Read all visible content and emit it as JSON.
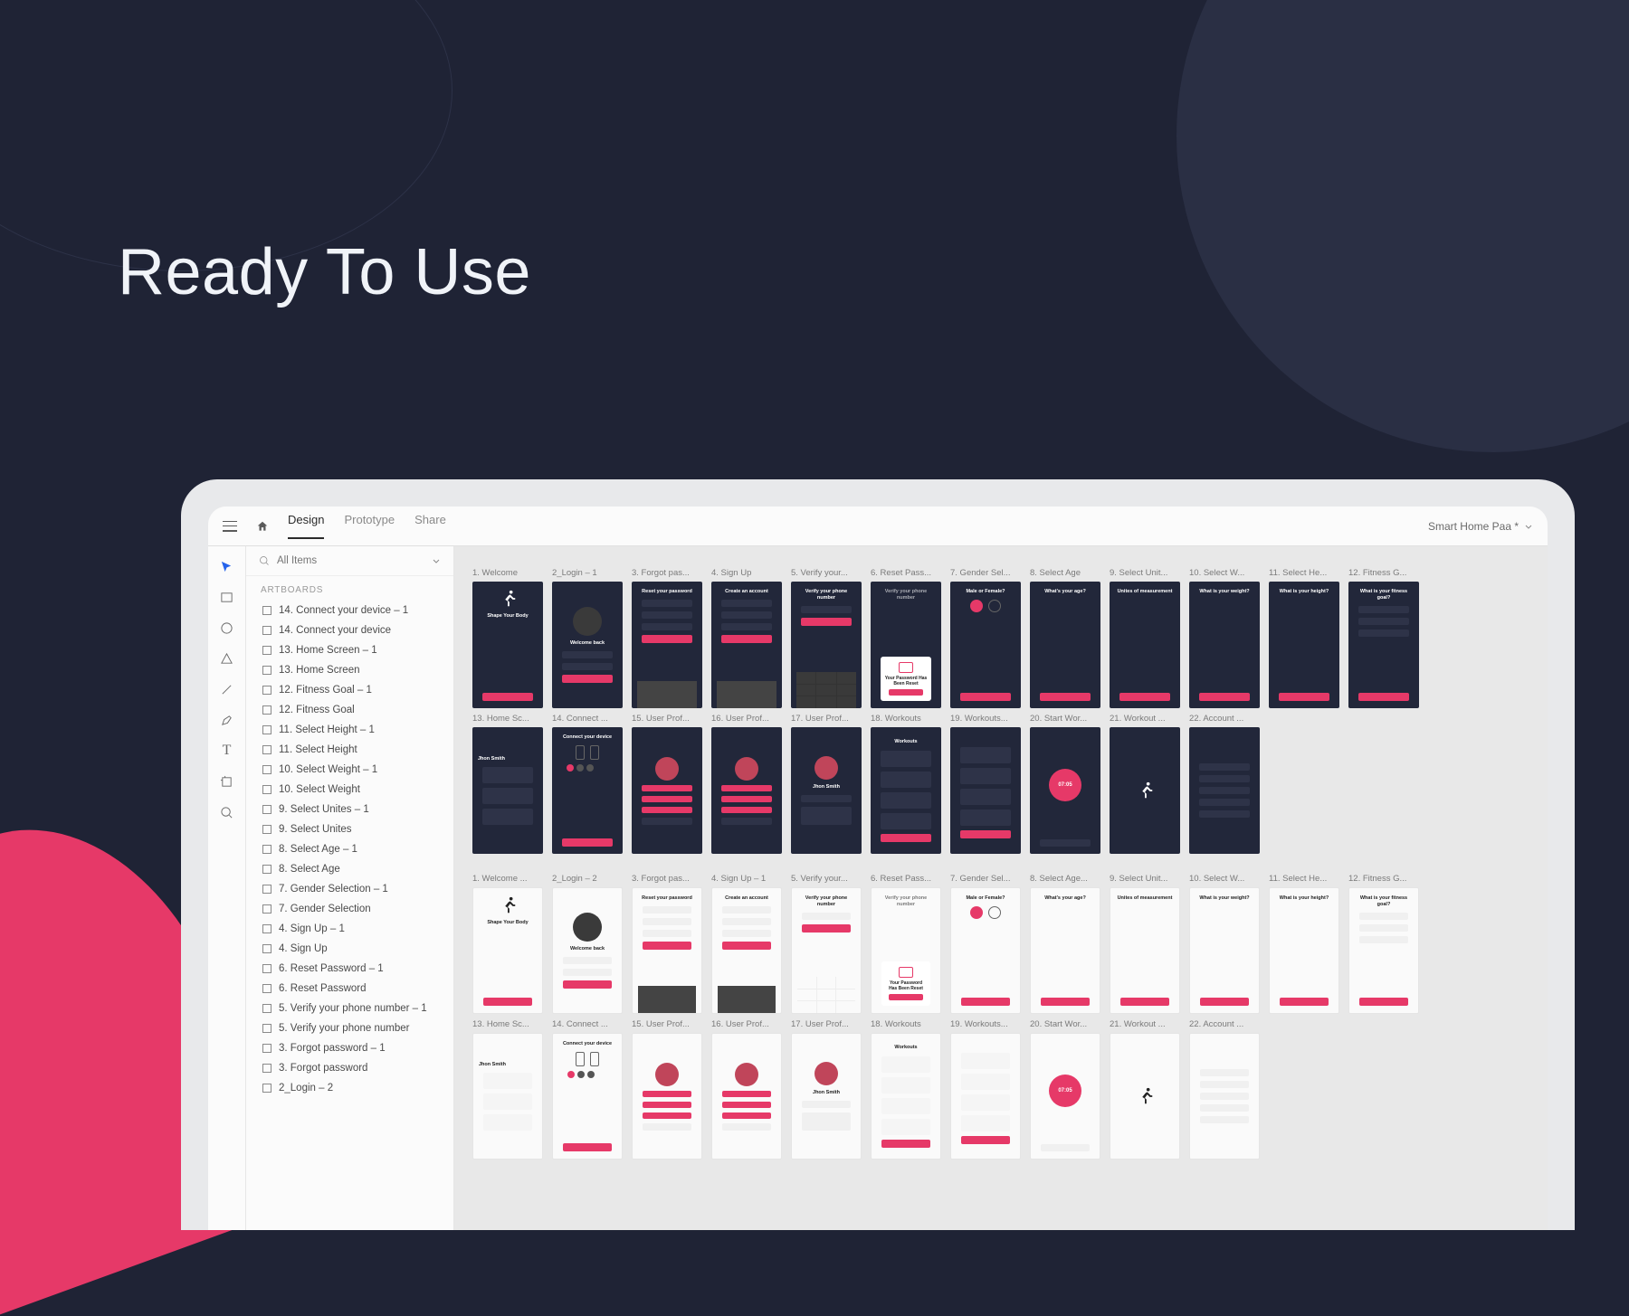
{
  "hero": "Ready To Use",
  "topbar": {
    "tabs": [
      "Design",
      "Prototype",
      "Share"
    ],
    "activeTab": 0,
    "docTitle": "Smart Home Paa *"
  },
  "layers": {
    "searchPlaceholder": "All Items",
    "sectionHeader": "ARTBOARDS",
    "items": [
      "14. Connect your device – 1",
      "14. Connect your device",
      "13. Home Screen – 1",
      "13. Home Screen",
      "12. Fitness Goal – 1",
      "12. Fitness Goal",
      "11. Select Height – 1",
      "11. Select Height",
      "10. Select Weight – 1",
      "10. Select Weight",
      "9. Select Unites – 1",
      "9. Select Unites",
      "8. Select Age – 1",
      "8. Select Age",
      "7. Gender Selection – 1",
      "7. Gender Selection",
      "4. Sign Up – 1",
      "4. Sign Up",
      "6. Reset Password – 1",
      "6. Reset Password",
      "5. Verify your phone number – 1",
      "5. Verify your phone number",
      "3. Forgot password – 1",
      "3. Forgot password",
      "2_Login – 2"
    ]
  },
  "artboardRows": [
    [
      {
        "label": "1. Welcome",
        "theme": "dark",
        "title": "Shape Your Body",
        "kind": "welcome"
      },
      {
        "label": "2_Login – 1",
        "theme": "dark",
        "title": "Welcome back",
        "kind": "login"
      },
      {
        "label": "3. Forgot pas...",
        "theme": "dark",
        "title": "Reset your password",
        "kind": "form"
      },
      {
        "label": "4. Sign Up",
        "theme": "dark",
        "title": "Create an account",
        "kind": "form"
      },
      {
        "label": "5. Verify your...",
        "theme": "dark",
        "title": "Verify your phone number",
        "kind": "verify"
      },
      {
        "label": "6. Reset Pass...",
        "theme": "dark",
        "title": "Your Password Has Been Reset",
        "kind": "modal"
      },
      {
        "label": "7. Gender Sel...",
        "theme": "dark",
        "title": "Male or Female?",
        "kind": "gender"
      },
      {
        "label": "8. Select Age",
        "theme": "dark",
        "title": "What's your age?",
        "kind": "picker"
      },
      {
        "label": "9. Select Unit...",
        "theme": "dark",
        "title": "Unites of measurement",
        "kind": "picker"
      },
      {
        "label": "10. Select W...",
        "theme": "dark",
        "title": "What is your weight?",
        "kind": "picker"
      },
      {
        "label": "11. Select He...",
        "theme": "dark",
        "title": "What is your height?",
        "kind": "picker"
      },
      {
        "label": "12. Fitness G...",
        "theme": "dark",
        "title": "What is your fitness goal?",
        "kind": "list"
      }
    ],
    [
      {
        "label": "13. Home Sc...",
        "theme": "dark",
        "title": "Jhon Smith",
        "kind": "home"
      },
      {
        "label": "14. Connect ...",
        "theme": "dark",
        "title": "Connect your device",
        "kind": "connect"
      },
      {
        "label": "15. User Prof...",
        "theme": "dark",
        "title": "",
        "kind": "profile"
      },
      {
        "label": "16. User Prof...",
        "theme": "dark",
        "title": "",
        "kind": "profile"
      },
      {
        "label": "17. User Prof...",
        "theme": "dark",
        "title": "Jhon Smith",
        "kind": "profile2"
      },
      {
        "label": "18. Workouts",
        "theme": "dark",
        "title": "Workouts",
        "kind": "workouts"
      },
      {
        "label": "19. Workouts...",
        "theme": "dark",
        "title": "",
        "kind": "workouts"
      },
      {
        "label": "20. Start Wor...",
        "theme": "dark",
        "title": "07:05",
        "kind": "timer"
      },
      {
        "label": "21. Workout ...",
        "theme": "dark",
        "title": "",
        "kind": "runner"
      },
      {
        "label": "22. Account ...",
        "theme": "dark",
        "title": "",
        "kind": "settings"
      }
    ],
    [
      {
        "label": "1. Welcome ...",
        "theme": "light",
        "title": "Shape Your Body",
        "kind": "welcome"
      },
      {
        "label": "2_Login – 2",
        "theme": "light",
        "title": "Welcome back",
        "kind": "login"
      },
      {
        "label": "3. Forgot pas...",
        "theme": "light",
        "title": "Reset your password",
        "kind": "form"
      },
      {
        "label": "4. Sign Up – 1",
        "theme": "light",
        "title": "Create an account",
        "kind": "form"
      },
      {
        "label": "5. Verify your...",
        "theme": "light",
        "title": "Verify your phone number",
        "kind": "verify"
      },
      {
        "label": "6. Reset Pass...",
        "theme": "light",
        "title": "Your Password Has Been Reset",
        "kind": "modal"
      },
      {
        "label": "7. Gender Sel...",
        "theme": "light",
        "title": "Male or Female?",
        "kind": "gender"
      },
      {
        "label": "8. Select Age...",
        "theme": "light",
        "title": "What's your age?",
        "kind": "picker"
      },
      {
        "label": "9. Select Unit...",
        "theme": "light",
        "title": "Unites of measurement",
        "kind": "picker"
      },
      {
        "label": "10. Select W...",
        "theme": "light",
        "title": "What is your weight?",
        "kind": "picker"
      },
      {
        "label": "11. Select He...",
        "theme": "light",
        "title": "What is your height?",
        "kind": "picker"
      },
      {
        "label": "12. Fitness G...",
        "theme": "light",
        "title": "What is your fitness goal?",
        "kind": "list"
      }
    ],
    [
      {
        "label": "13. Home Sc...",
        "theme": "light",
        "title": "Jhon Smith",
        "kind": "home"
      },
      {
        "label": "14. Connect ...",
        "theme": "light",
        "title": "Connect your device",
        "kind": "connect"
      },
      {
        "label": "15. User Prof...",
        "theme": "light",
        "title": "",
        "kind": "profile"
      },
      {
        "label": "16. User Prof...",
        "theme": "light",
        "title": "",
        "kind": "profile"
      },
      {
        "label": "17. User Prof...",
        "theme": "light",
        "title": "Jhon Smith",
        "kind": "profile2"
      },
      {
        "label": "18. Workouts",
        "theme": "light",
        "title": "Workouts",
        "kind": "workouts"
      },
      {
        "label": "19. Workouts...",
        "theme": "light",
        "title": "",
        "kind": "workouts"
      },
      {
        "label": "20. Start Wor...",
        "theme": "light",
        "title": "07:05",
        "kind": "timer"
      },
      {
        "label": "21. Workout ...",
        "theme": "light",
        "title": "",
        "kind": "runner"
      },
      {
        "label": "22. Account ...",
        "theme": "light",
        "title": "",
        "kind": "settings"
      }
    ]
  ]
}
